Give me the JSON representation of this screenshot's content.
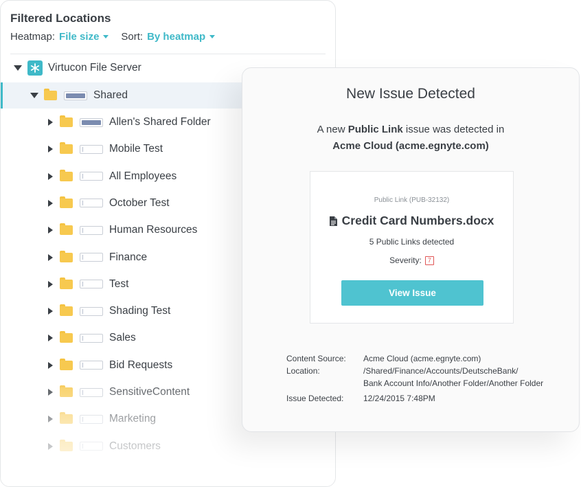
{
  "panel": {
    "title": "Filtered Locations",
    "heatmap_label": "Heatmap:",
    "heatmap_value": "File size",
    "sort_label": "Sort:",
    "sort_value": "By heatmap"
  },
  "tree": {
    "server": "Virtucon File Server",
    "root_folder": "Shared",
    "root_heat": 1.0,
    "folders": [
      {
        "label": "Allen's Shared Folder",
        "heat": 1.0
      },
      {
        "label": "Mobile Test",
        "heat": 0.02
      },
      {
        "label": "All Employees",
        "heat": 0.02
      },
      {
        "label": "October Test",
        "heat": 0.02
      },
      {
        "label": "Human Resources",
        "heat": 0.02
      },
      {
        "label": "Finance",
        "heat": 0.02
      },
      {
        "label": "Test",
        "heat": 0.02
      },
      {
        "label": "Shading Test",
        "heat": 0.02
      },
      {
        "label": "Sales",
        "heat": 0.02
      },
      {
        "label": "Bid Requests",
        "heat": 0.02
      },
      {
        "label": "SensitiveContent",
        "heat": 0.02
      },
      {
        "label": "Marketing",
        "heat": 0.02
      },
      {
        "label": "Customers",
        "heat": 0.02
      }
    ]
  },
  "issue": {
    "title": "New Issue Detected",
    "desc_prefix": "A new ",
    "issue_type": "Public Link",
    "desc_suffix": " issue was detected in",
    "source_name": "Acme Cloud (acme.egnyte.com)",
    "pub_id": "Public Link (PUB-32132)",
    "file_name": "Credit Card Numbers.docx",
    "links_detected": "5 Public Links detected",
    "severity_label": "Severity:",
    "severity_value": "7",
    "button_label": "View Issue",
    "meta": [
      {
        "key": "Content Source:",
        "value": "Acme Cloud (acme.egnyte.com)"
      },
      {
        "key": "Location:",
        "value": "/Shared/Finance/Accounts/DeutscheBank/"
      },
      {
        "key": "",
        "value": "Bank Account Info/Another Folder/Another Folder"
      },
      {
        "key": "Issue Detected:",
        "value": "12/24/2015 7:48PM"
      }
    ]
  },
  "colors": {
    "accent": "#3fb9c8",
    "button": "#4fc3d0",
    "folder": "#f7c94f",
    "heat_fill": "#7b8cb0",
    "severity": "#e05555"
  },
  "icons": {
    "server": "virtucon-server-icon",
    "folder": "folder-icon",
    "document": "document-icon",
    "expand": "caret-right-icon",
    "collapse": "caret-down-icon"
  }
}
